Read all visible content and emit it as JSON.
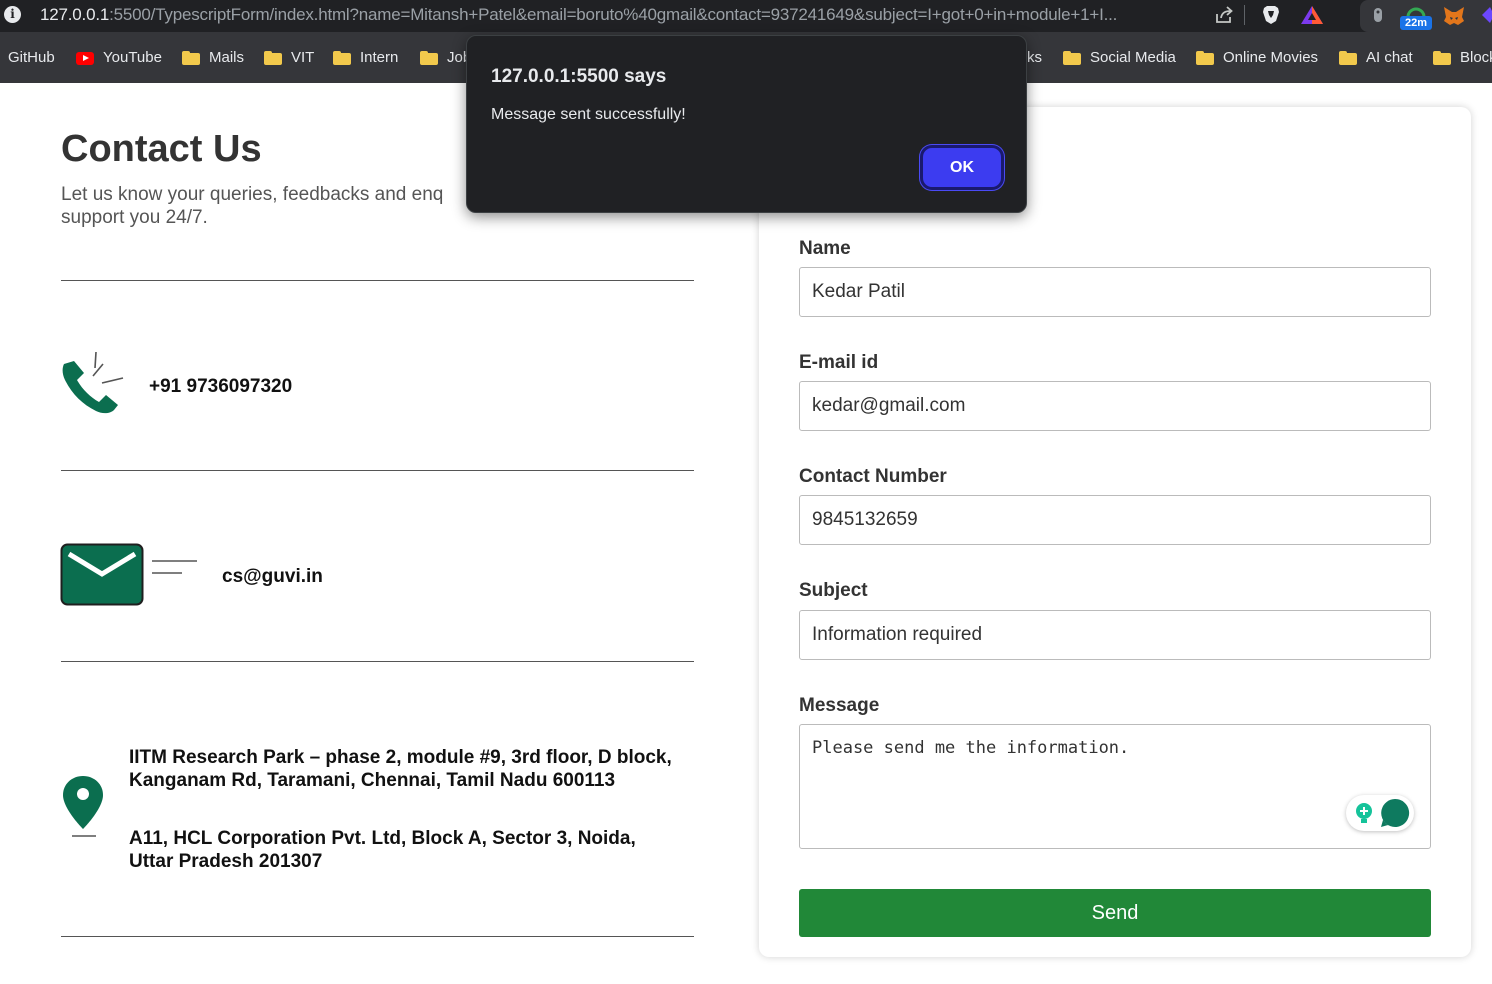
{
  "browser": {
    "url_host": "127.0.0.1",
    "url_rest": ":5500/TypescriptForm/index.html?name=Mitansh+Patel&email=boruto%40gmail&contact=937241649&subject=I+got+0+in+module+1+I...",
    "extension_badge": "22m",
    "bookmarks": [
      {
        "label": "GitHub"
      },
      {
        "label": "YouTube"
      },
      {
        "label": "Mails"
      },
      {
        "label": "VIT"
      },
      {
        "label": "Intern"
      },
      {
        "label": "Job"
      },
      {
        "label": "ks"
      },
      {
        "label": "Social Media"
      },
      {
        "label": "Online Movies"
      },
      {
        "label": "AI chat"
      },
      {
        "label": "Block"
      }
    ]
  },
  "contact": {
    "title": "Contact Us",
    "description": "Let us know your queries, feedbacks and enq\nsupport you 24/7.",
    "phone": "+91 9736097320",
    "email": "cs@guvi.in",
    "address_1": "IITM Research Park – phase 2, module #9, 3rd floor, D block, Kanganam Rd, Taramani, Chennai, Tamil Nadu 600113",
    "address_2": "A11, HCL Corporation Pvt. Ltd, Block A, Sector 3, Noida, Uttar Pradesh 201307"
  },
  "form": {
    "name_label": "Name",
    "name_value": "Kedar Patil",
    "email_label": "E-mail id",
    "email_value": "kedar@gmail.com",
    "contact_label": "Contact Number",
    "contact_value": "9845132659",
    "subject_label": "Subject",
    "subject_value": "Information required",
    "message_label": "Message",
    "message_value": "Please send me the information.",
    "send_label": "Send"
  },
  "dialog": {
    "title": "127.0.0.1:5500 says",
    "message": "Message sent successfully!",
    "ok_label": "OK"
  },
  "colors": {
    "icon_green": "#0b6e4f",
    "send_button": "#218838",
    "dialog_ok": "#3c3cf0"
  }
}
